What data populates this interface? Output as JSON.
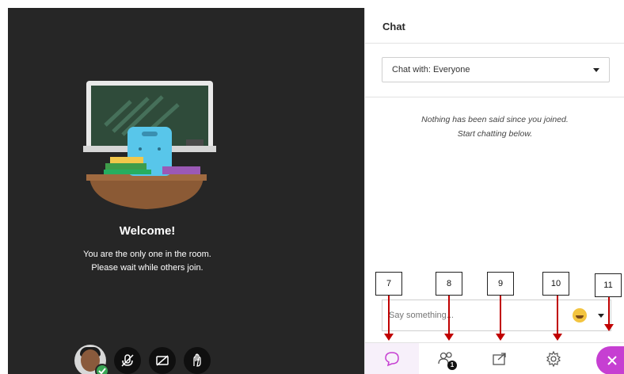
{
  "stage": {
    "welcome_title": "Welcome!",
    "welcome_line1": "You are the only one in the room.",
    "welcome_line2": "Please wait while others join.",
    "controls": [
      "avatar",
      "microphone-off-icon",
      "camera-off-icon",
      "share-hand-icon"
    ]
  },
  "chat_panel": {
    "title": "Chat",
    "chat_with": "Chat with: Everyone",
    "empty_line1": "Nothing has been said since you joined.",
    "empty_line2": "Start chatting below.",
    "input_placeholder": "Say something...",
    "participants_badge": "1"
  },
  "callouts": [
    "7",
    "8",
    "9",
    "10",
    "11"
  ],
  "colors": {
    "stage_bg": "#262626",
    "accent_purple": "#c63fd2",
    "arrow_red": "#c00000",
    "status_green": "#3aa655"
  }
}
